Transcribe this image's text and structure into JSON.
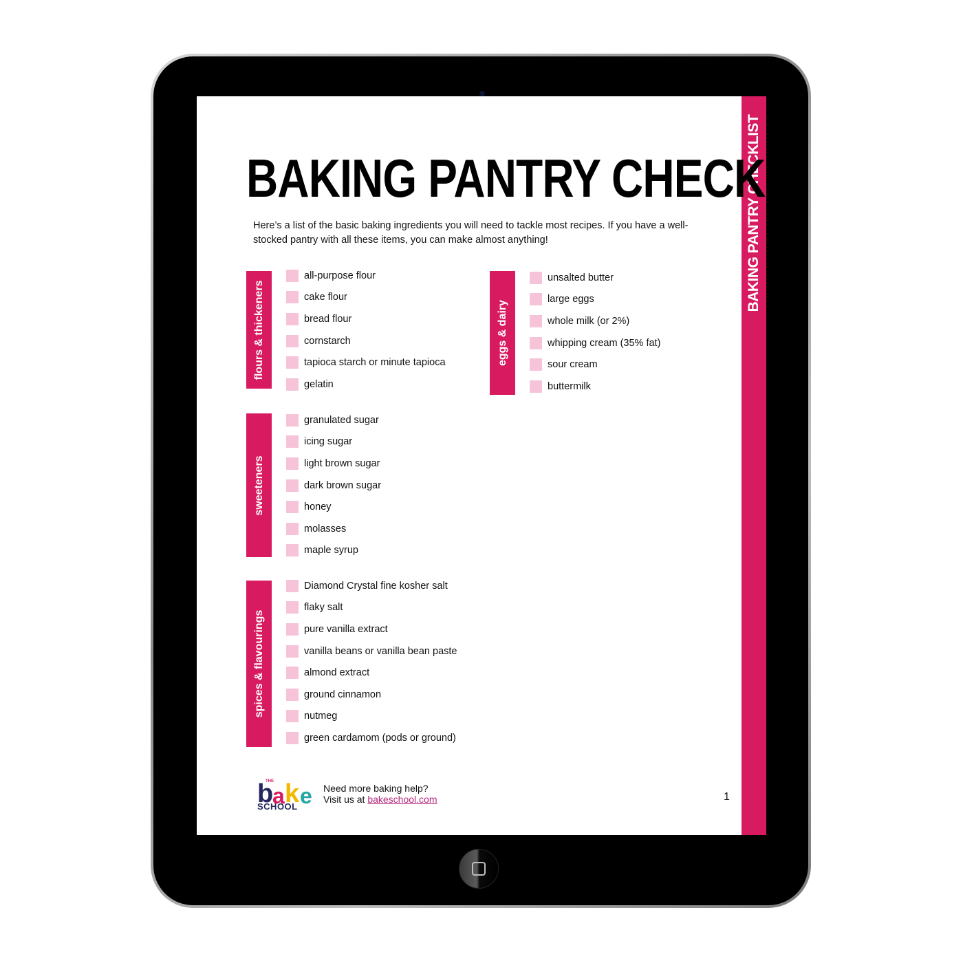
{
  "document": {
    "title": "BAKING PANTRY CHECKLIST",
    "side_band_title": "BAKING PANTRY CHECKLIST",
    "intro": "Here’s a list of the basic baking ingredients you will need to tackle most recipes. If you have a well-stocked pantry with all these items, you can make almost anything!",
    "page_number": "1",
    "accent_color": "#d81b60",
    "checkbox_color": "#f6c3d8"
  },
  "categories": [
    {
      "label": "flours & thickeners",
      "items": [
        "all-purpose flour",
        "cake flour",
        "bread flour",
        "cornstarch",
        "tapioca starch or minute tapioca",
        "gelatin"
      ]
    },
    {
      "label": "sweeteners",
      "items": [
        "granulated sugar",
        "icing sugar",
        "light brown sugar",
        "dark brown sugar",
        "honey",
        "molasses",
        "maple syrup"
      ]
    },
    {
      "label": "spices & flavourings",
      "items": [
        "Diamond Crystal fine kosher salt",
        "flaky salt",
        "pure vanilla extract",
        "vanilla beans or vanilla bean paste",
        "almond extract",
        "ground cinnamon",
        "nutmeg",
        "green cardamom (pods or ground)"
      ]
    },
    {
      "label": "eggs & dairy",
      "items": [
        "unsalted butter",
        "large eggs",
        "whole milk (or 2%)",
        "whipping cream (35% fat)",
        "sour cream",
        "buttermilk"
      ]
    }
  ],
  "footer": {
    "logo": {
      "the": "THE",
      "b": "b",
      "a": "a",
      "k": "k",
      "e": "e",
      "school": "SCHOOL"
    },
    "line1": "Need more baking help?",
    "line2_prefix": "Visit us at ",
    "link_text": "bakeschool.com"
  }
}
